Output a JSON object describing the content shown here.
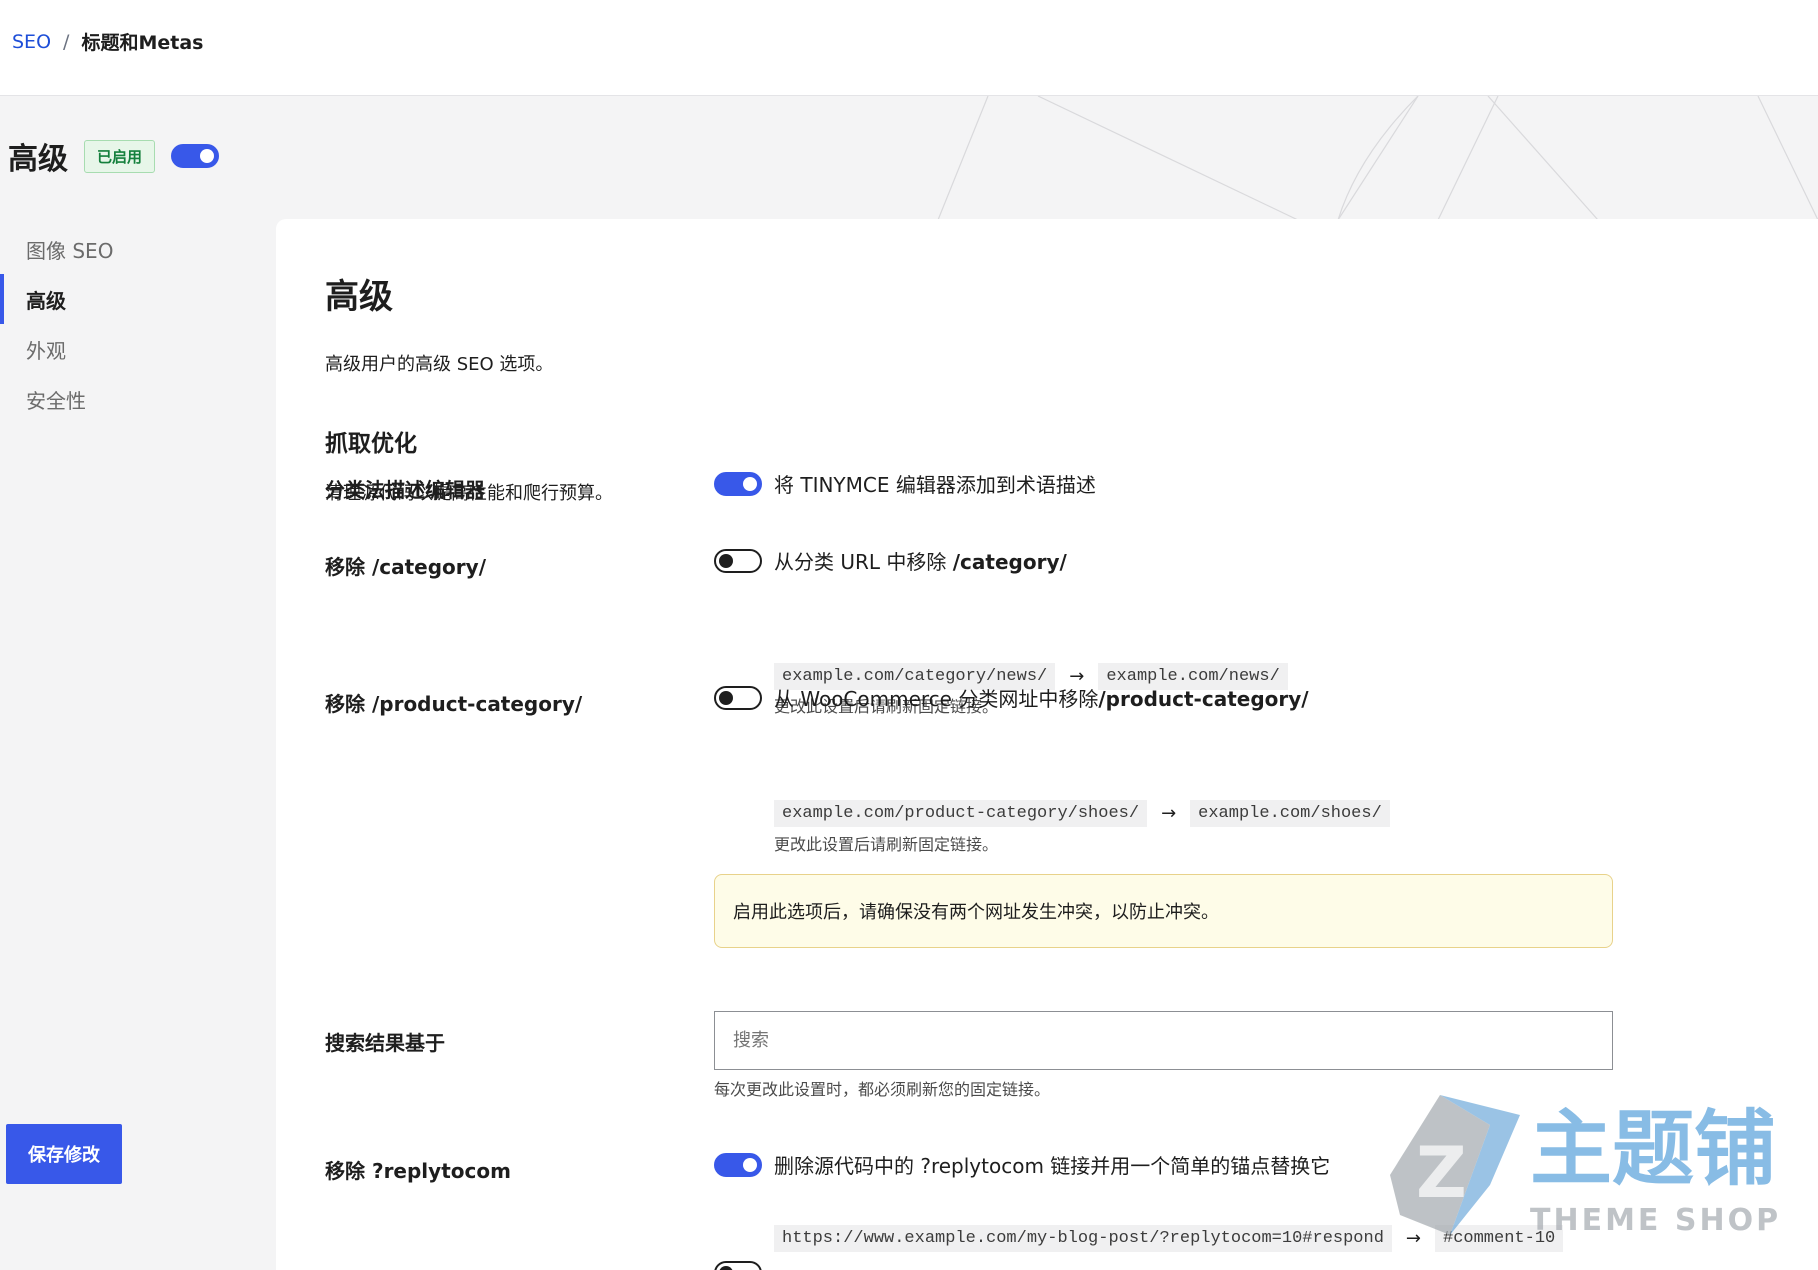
{
  "breadcrumb": {
    "root": "SEO",
    "separator": "/",
    "current": "标题和Metas"
  },
  "module": {
    "title": "高级",
    "status_badge": "已启用",
    "enabled": true
  },
  "sidebar": {
    "items": [
      {
        "label": "图像 SEO",
        "active": false
      },
      {
        "label": "高级",
        "active": true
      },
      {
        "label": "外观",
        "active": false
      },
      {
        "label": "安全性",
        "active": false
      }
    ]
  },
  "save_button": {
    "label": "保存修改"
  },
  "main": {
    "title": "高级",
    "description": "高级用户的高级 SEO 选项。",
    "section": {
      "title": "抓取优化",
      "description": "清理源代码以提高性能和爬行预算。"
    },
    "rows": {
      "taxonomy_editor": {
        "label": "分类法描述编辑器",
        "enabled": true,
        "option_text": "将 TINYMCE 编辑器添加到术语描述"
      },
      "remove_category": {
        "label": "移除 /category/",
        "enabled": false,
        "option_prefix": "从分类 URL 中移除 ",
        "option_bold": "/category/",
        "code_from": "example.com/category/news/",
        "arrow": "→",
        "code_to": "example.com/news/",
        "hint": "更改此设置后请刷新固定链接。"
      },
      "remove_product_category": {
        "label": "移除 /product-category/",
        "enabled": false,
        "option_prefix": "从 WooCommerce 分类网址中移除",
        "option_bold": "/product-category/",
        "code_from": "example.com/product-category/shoes/",
        "arrow": "→",
        "code_to": "example.com/shoes/",
        "hint": "更改此设置后请刷新固定链接。",
        "notice": "启用此选项后，请确保没有两个网址发生冲突，以防止冲突。"
      },
      "search_base": {
        "label": "搜索结果基于",
        "placeholder": "搜索",
        "hint": "每次更改此设置时，都必须刷新您的固定链接。"
      },
      "remove_replytocom": {
        "label": "移除 ?replytocom",
        "enabled": true,
        "option_text": "删除源代码中的 ?replytocom 链接并用一个简单的锚点替换它",
        "code_from": "https://www.example.com/my-blog-post/?replytocom=10#respond",
        "arrow": "→",
        "code_to": "#comment-10"
      }
    }
  },
  "watermark": {
    "cn": "主题铺",
    "en": "THEME SHOP"
  },
  "colors": {
    "accent": "#3858e9",
    "badge_bg": "#e7f6e9",
    "badge_text": "#15803d",
    "notice_bg": "#fefce8"
  }
}
